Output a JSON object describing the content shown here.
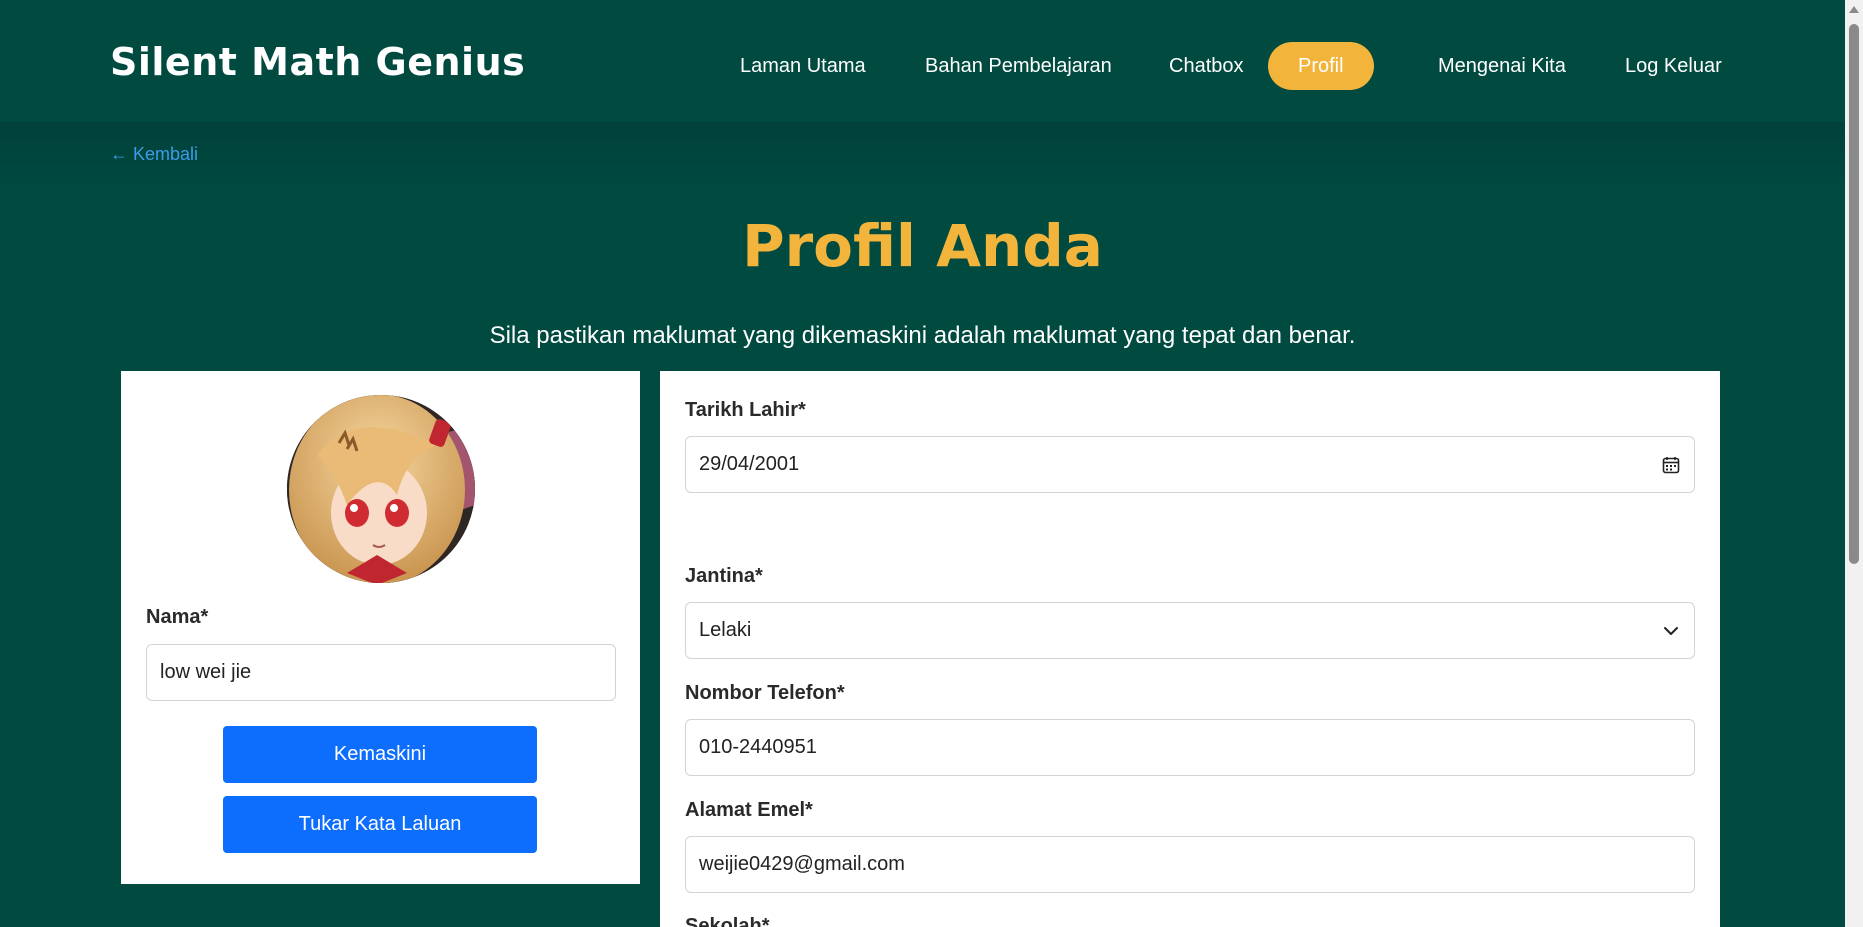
{
  "brand": "Silent Math Genius",
  "nav": {
    "items": [
      {
        "label": "Laman Utama"
      },
      {
        "label": "Bahan Pembelajaran"
      },
      {
        "label": "Chatbox"
      },
      {
        "label": "Profil"
      },
      {
        "label": "Mengenai Kita"
      },
      {
        "label": "Log Keluar"
      }
    ],
    "active": "Profil"
  },
  "back": {
    "label": "← Kembali"
  },
  "page": {
    "title": "Profil Anda",
    "subtitle": "Sila pastikan maklumat yang dikemaskini adalah maklumat yang tepat dan benar."
  },
  "profile": {
    "name_label": "Nama*",
    "name_value": "low wei jie",
    "update_button": "Kemaskini",
    "change_password_button": "Tukar Kata Laluan"
  },
  "form": {
    "dob_label": "Tarikh Lahir*",
    "dob_value": "29/04/2001",
    "gender_label": "Jantina*",
    "gender_value": "Lelaki",
    "phone_label": "Nombor Telefon*",
    "phone_value": "010-2440951",
    "email_label": "Alamat Emel*",
    "email_value": "weijie0429@gmail.com",
    "school_label": "Sekolah*"
  },
  "colors": {
    "background": "#004a40",
    "accent": "#f2b43a",
    "primary_button": "#0d6efd",
    "link": "#3d9be9"
  },
  "icons": {
    "date": "calendar-icon",
    "select": "chevron-down-icon"
  }
}
